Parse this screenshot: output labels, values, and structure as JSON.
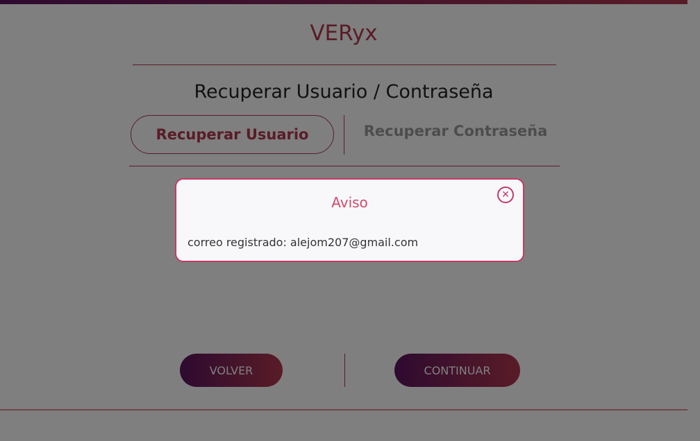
{
  "app": {
    "brand": "VERyx"
  },
  "page": {
    "heading": "Recuperar Usuario / Contraseña"
  },
  "tabs": [
    {
      "label": "Recuperar Usuario",
      "active": true
    },
    {
      "label": "Recuperar Contraseña",
      "active": false
    }
  ],
  "buttons": {
    "back": "VOLVER",
    "continue": "CONTINUAR"
  },
  "modal": {
    "title": "Aviso",
    "close_icon": "close-circle-icon",
    "message": "correo registrado: alejom207@gmail.com"
  },
  "colors": {
    "accent": "#b3384f",
    "gradient_start": "#5c1560",
    "gradient_end": "#b3384f",
    "inactive_text": "#9a9a9a"
  }
}
